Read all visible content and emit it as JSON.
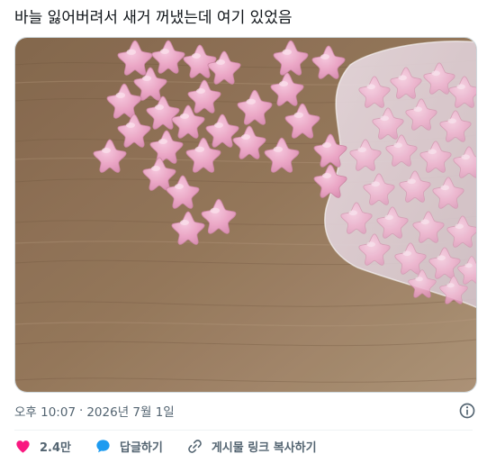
{
  "post": {
    "text": "바늘 잃어버려서 새거 꺼냈는데 여기 있었음",
    "media_description": "pink star shaped beads scattered on a wooden table next to a clear plastic bag full of pink stars"
  },
  "meta": {
    "time": "오후 10:07",
    "separator": "·",
    "date": "2026년 7월 1일"
  },
  "actions": {
    "like_count": "2.4만",
    "reply_label": "답글하기",
    "copy_link_label": "게시물 링크 복사하기"
  },
  "colors": {
    "like": "#f91880",
    "reply": "#1d9bf0",
    "meta_text": "#536471",
    "star_pink": "#eaa3c6",
    "wood": "#8a6a4a"
  },
  "icons": {
    "like": "heart-icon",
    "reply": "speech-bubble-icon",
    "copy_link": "link-icon",
    "info": "info-circle-icon"
  }
}
